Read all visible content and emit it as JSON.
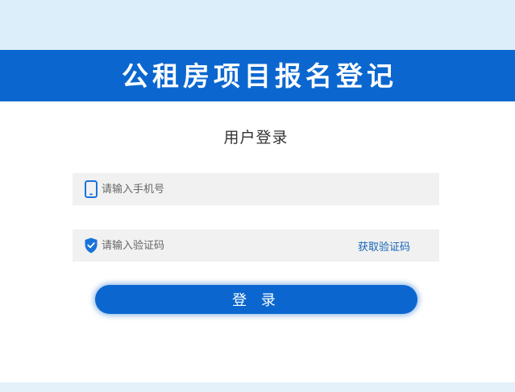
{
  "header": {
    "title": "公租房项目报名登记"
  },
  "login_form": {
    "title": "用户登录",
    "phone_field": {
      "icon": "mobile-phone-icon",
      "value": "",
      "placeholder": "请输入手机号"
    },
    "code_field": {
      "icon": "shield-check-icon",
      "value": "",
      "placeholder": "请输入验证码",
      "get_code_label": "获取验证码"
    },
    "submit_label": "登 录"
  },
  "colors": {
    "brand_blue": "#0b67cf",
    "link_blue": "#1763b8",
    "top_band": "#dceef9",
    "field_background": "#f1f1f1"
  }
}
